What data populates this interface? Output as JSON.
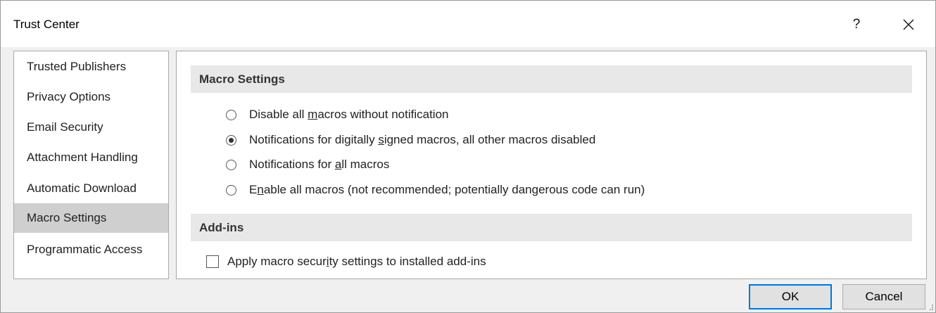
{
  "window": {
    "title": "Trust Center",
    "help_label": "?",
    "close_icon": "close-icon"
  },
  "nav": {
    "items": [
      {
        "label": "Trusted Publishers",
        "selected": false
      },
      {
        "label": "Privacy Options",
        "selected": false
      },
      {
        "label": "Email Security",
        "selected": false
      },
      {
        "label": "Attachment Handling",
        "selected": false
      },
      {
        "label": "Automatic Download",
        "selected": false
      },
      {
        "label": "Macro Settings",
        "selected": true
      },
      {
        "label": "Programmatic Access",
        "selected": false
      }
    ]
  },
  "macro_settings": {
    "header": "Macro Settings",
    "options": [
      {
        "before": "Disable all ",
        "accel": "m",
        "after": "acros without notification",
        "checked": false
      },
      {
        "before": "Notifications for digitally ",
        "accel": "s",
        "after": "igned macros, all other macros disabled",
        "checked": true
      },
      {
        "before": "Notifications for ",
        "accel": "a",
        "after": "ll macros",
        "checked": false
      },
      {
        "before": "E",
        "accel": "n",
        "after": "able all macros (not recommended; potentially dangerous code can run)",
        "checked": false
      }
    ]
  },
  "addins": {
    "header": "Add-ins",
    "checkbox": {
      "before": "Apply macro secur",
      "accel": "i",
      "after": "ty settings to installed add-ins",
      "checked": false
    }
  },
  "buttons": {
    "ok": "OK",
    "cancel": "Cancel"
  },
  "colors": {
    "selected_nav": "#cfcfcf",
    "section_header": "#e8e8e8",
    "focus_border": "#0078d7"
  }
}
